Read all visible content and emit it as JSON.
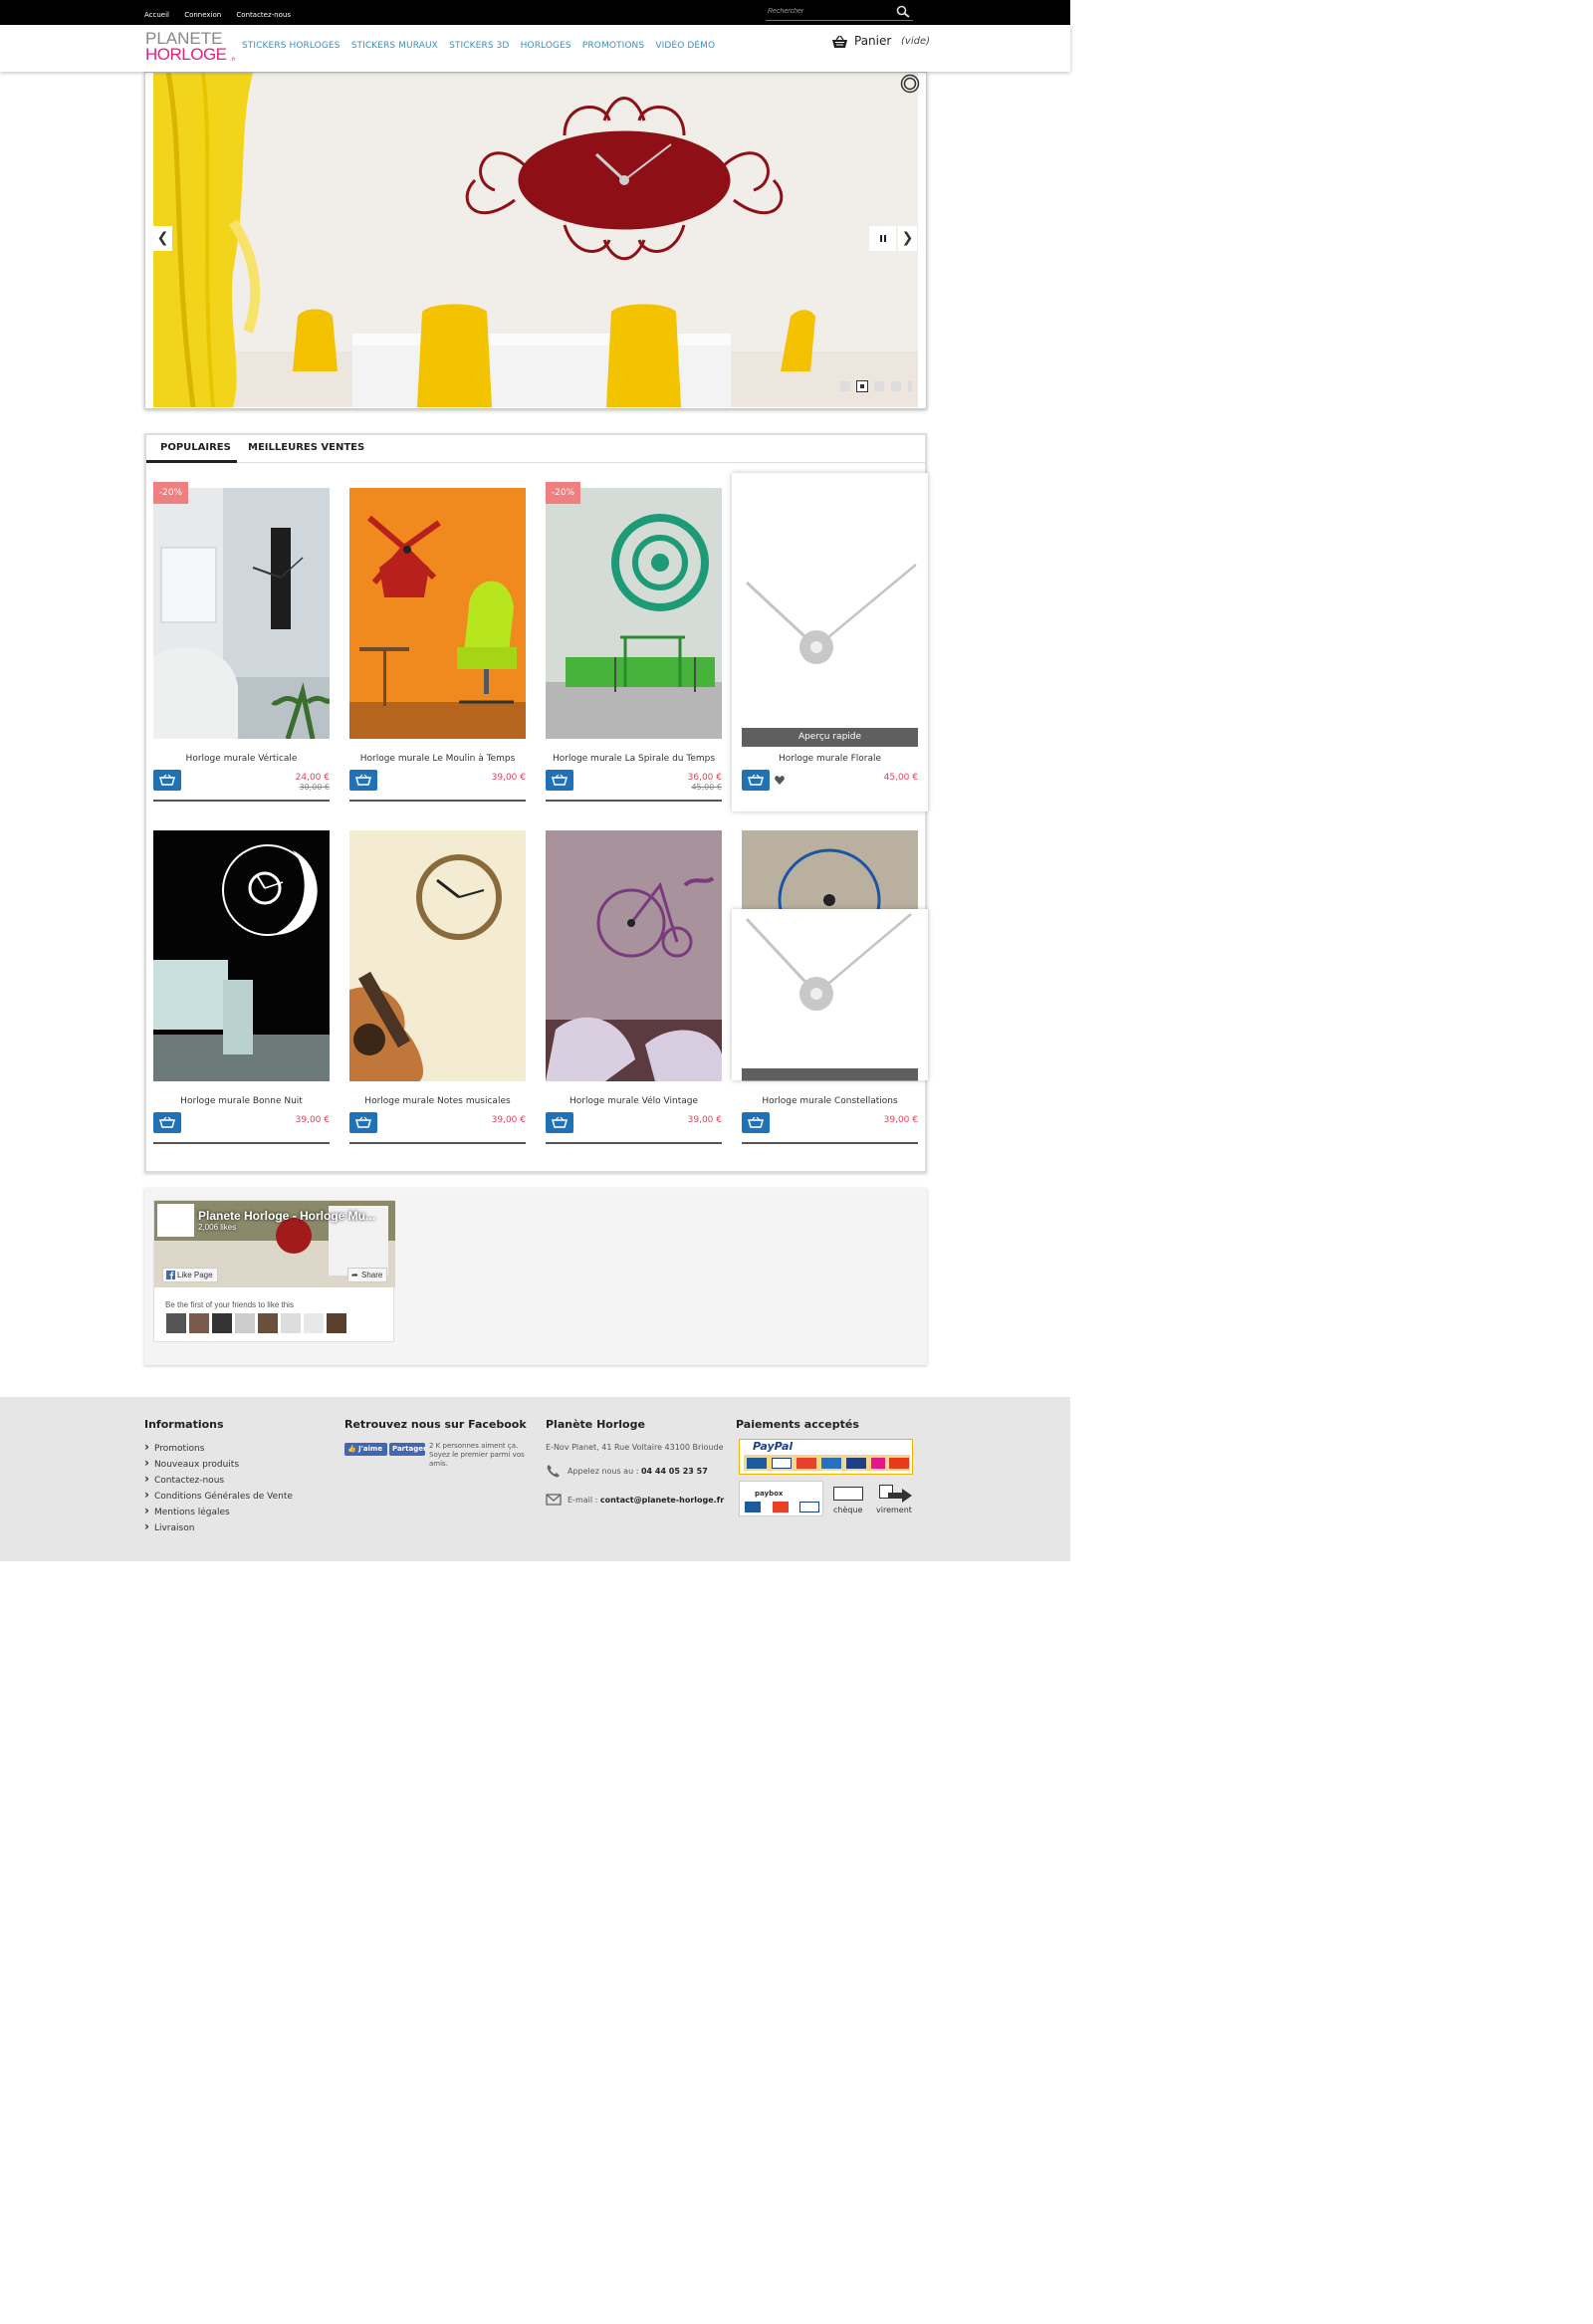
{
  "topbar": {
    "links": [
      "Accueil",
      "Connexion",
      "Contactez-nous"
    ],
    "search_placeholder": "Rechercher"
  },
  "header": {
    "logo_line1": "PLANETE",
    "logo_line2": "HORLOGE",
    "logo_tld": ".fr",
    "nav": [
      "STICKERS HORLOGES",
      "STICKERS MURAUX",
      "STICKERS 3D",
      "HORLOGES",
      "PROMOTIONS",
      "VIDÉO DÉMO"
    ],
    "cart_label": "Panier",
    "cart_status": "(vide)"
  },
  "slider": {
    "slides_count": 5,
    "active_index": 1
  },
  "tabs": [
    "POPULAIRES",
    "MEILLEURES VENTES"
  ],
  "active_tab": 0,
  "quick_view_label": "Aperçu rapide",
  "products": [
    {
      "name": "Horloge murale Vérticale",
      "price": "24,00 €",
      "old_price": "30,00 €",
      "discount": "-20%"
    },
    {
      "name": "Horloge murale Le Moulin à Temps",
      "price": "39,00 €"
    },
    {
      "name": "Horloge murale La Spirale du Temps",
      "price": "36,00 €",
      "old_price": "45,00 €",
      "discount": "-20%"
    },
    {
      "name": "Horloge murale Florale",
      "price": "45,00 €"
    },
    {
      "name": "Horloge murale Bonne Nuit",
      "price": "39,00 €"
    },
    {
      "name": "Horloge murale Notes musicales",
      "price": "39,00 €"
    },
    {
      "name": "Horloge murale Vélo Vintage",
      "price": "39,00 €"
    },
    {
      "name": "Horloge murale Constellations",
      "price": "39,00 €"
    }
  ],
  "facebook_widget": {
    "title": "Planete Horloge - Horloge Mu...",
    "likes": "2,006 likes",
    "like_btn": "Like Page",
    "share_btn": "Share",
    "first_text": "Be the first of your friends to like this"
  },
  "footer": {
    "info_title": "Informations",
    "info_links": [
      "Promotions",
      "Nouveaux produits",
      "Contactez-nous",
      "Conditions Générales de Vente",
      "Mentions légales",
      "Livraison"
    ],
    "fb_title": "Retrouvez nous sur Facebook",
    "fb_jaime": "J'aime",
    "fb_partager": "Partager",
    "fb_text": "2 K personnes aiment ça. Soyez le premier parmi vos amis.",
    "store_title": "Planète Horloge",
    "store_address": "E-Nov Planet, 41 Rue Voltaire 43100 Brioude",
    "phone_label": "Appelez nous au :",
    "phone": "04 44 05 23 57",
    "email_label": "E-mail :",
    "email": "contact@planete-horloge.fr",
    "pay_title": "Paiements acceptés",
    "pay_paypal": "PayPal",
    "pay_paybox": "paybox",
    "pay_cheque": "chèque",
    "pay_virement": "virement"
  },
  "colors": {
    "nav_blue": "#3b8fc6",
    "logo_pink": "#e0227c",
    "price_red": "#e4415e",
    "cart_button": "#1f72b8",
    "badge": "#f08080"
  }
}
